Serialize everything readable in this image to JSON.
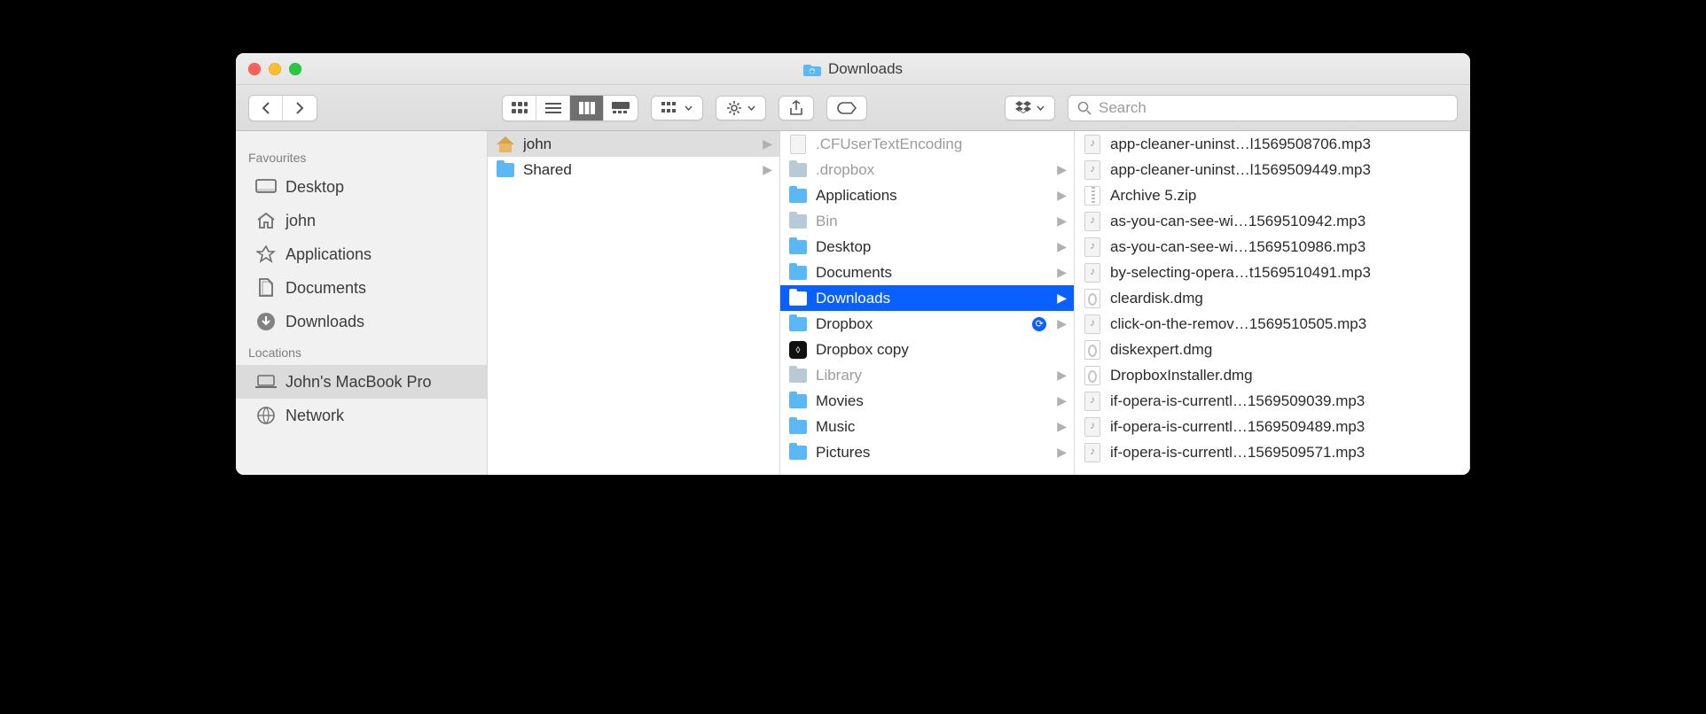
{
  "window": {
    "title": "Downloads"
  },
  "search": {
    "placeholder": "Search"
  },
  "sidebar": {
    "group1_label": "Favourites",
    "group2_label": "Locations",
    "favourites": [
      {
        "label": "Desktop",
        "icon": "desktop"
      },
      {
        "label": "john",
        "icon": "home"
      },
      {
        "label": "Applications",
        "icon": "apps"
      },
      {
        "label": "Documents",
        "icon": "docs"
      },
      {
        "label": "Downloads",
        "icon": "download-circle"
      }
    ],
    "locations": [
      {
        "label": "John's MacBook Pro",
        "icon": "laptop",
        "selected": true
      },
      {
        "label": "Network",
        "icon": "globe"
      }
    ]
  },
  "columns": {
    "c1": [
      {
        "label": "john",
        "icon": "home",
        "arrow": true,
        "state": "expanded"
      },
      {
        "label": "Shared",
        "icon": "folder",
        "arrow": true
      }
    ],
    "c2": [
      {
        "label": ".CFUserTextEncoding",
        "icon": "file",
        "arrow": false,
        "dim": true
      },
      {
        "label": ".dropbox",
        "icon": "folder",
        "arrow": true,
        "dim": true
      },
      {
        "label": "Applications",
        "icon": "folder",
        "arrow": true
      },
      {
        "label": "Bin",
        "icon": "folder",
        "arrow": true,
        "dim": true
      },
      {
        "label": "Desktop",
        "icon": "folder",
        "arrow": true
      },
      {
        "label": "Documents",
        "icon": "folder",
        "arrow": true
      },
      {
        "label": "Downloads",
        "icon": "folder",
        "arrow": true,
        "state": "active"
      },
      {
        "label": "Dropbox",
        "icon": "folder",
        "arrow": true,
        "sync": true
      },
      {
        "label": "Dropbox copy",
        "icon": "dropbox-app",
        "arrow": false
      },
      {
        "label": "Library",
        "icon": "folder",
        "arrow": true,
        "dim": true
      },
      {
        "label": "Movies",
        "icon": "folder",
        "arrow": true
      },
      {
        "label": "Music",
        "icon": "folder",
        "arrow": true
      },
      {
        "label": "Pictures",
        "icon": "folder",
        "arrow": true
      }
    ],
    "c3": [
      {
        "label": "app-cleaner-uninst…l1569508706.mp3",
        "icon": "audio"
      },
      {
        "label": "app-cleaner-uninst…l1569509449.mp3",
        "icon": "audio"
      },
      {
        "label": "Archive 5.zip",
        "icon": "zip"
      },
      {
        "label": "as-you-can-see-wi…1569510942.mp3",
        "icon": "audio"
      },
      {
        "label": "as-you-can-see-wi…1569510986.mp3",
        "icon": "audio"
      },
      {
        "label": "by-selecting-opera…t1569510491.mp3",
        "icon": "audio"
      },
      {
        "label": "cleardisk.dmg",
        "icon": "dmg"
      },
      {
        "label": "click-on-the-remov…1569510505.mp3",
        "icon": "audio"
      },
      {
        "label": "diskexpert.dmg",
        "icon": "dmg"
      },
      {
        "label": "DropboxInstaller.dmg",
        "icon": "dmg"
      },
      {
        "label": "if-opera-is-currentl…1569509039.mp3",
        "icon": "audio"
      },
      {
        "label": "if-opera-is-currentl…1569509489.mp3",
        "icon": "audio"
      },
      {
        "label": "if-opera-is-currentl…1569509571.mp3",
        "icon": "audio"
      }
    ]
  }
}
